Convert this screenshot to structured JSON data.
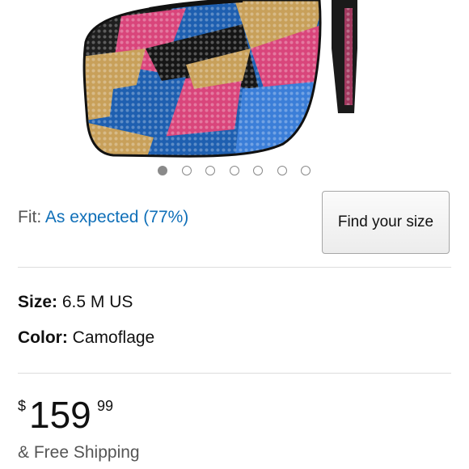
{
  "product": {
    "image_alt": "Multicolor rhinestone camouflage platform pump",
    "carousel": {
      "count": 7,
      "active_index": 0
    }
  },
  "fit": {
    "label": "Fit:",
    "value": "As expected (77%)",
    "find_size_button": "Find your size"
  },
  "specs": {
    "size_label": "Size:",
    "size_value": "6.5 M US",
    "color_label": "Color:",
    "color_value": "Camoflage"
  },
  "price": {
    "currency": "$",
    "whole": "159",
    "fraction": "99"
  },
  "shipping": "& Free Shipping",
  "colors": {
    "link": "#0f6fb8",
    "muted_text": "#555555",
    "divider": "#dddddd"
  }
}
